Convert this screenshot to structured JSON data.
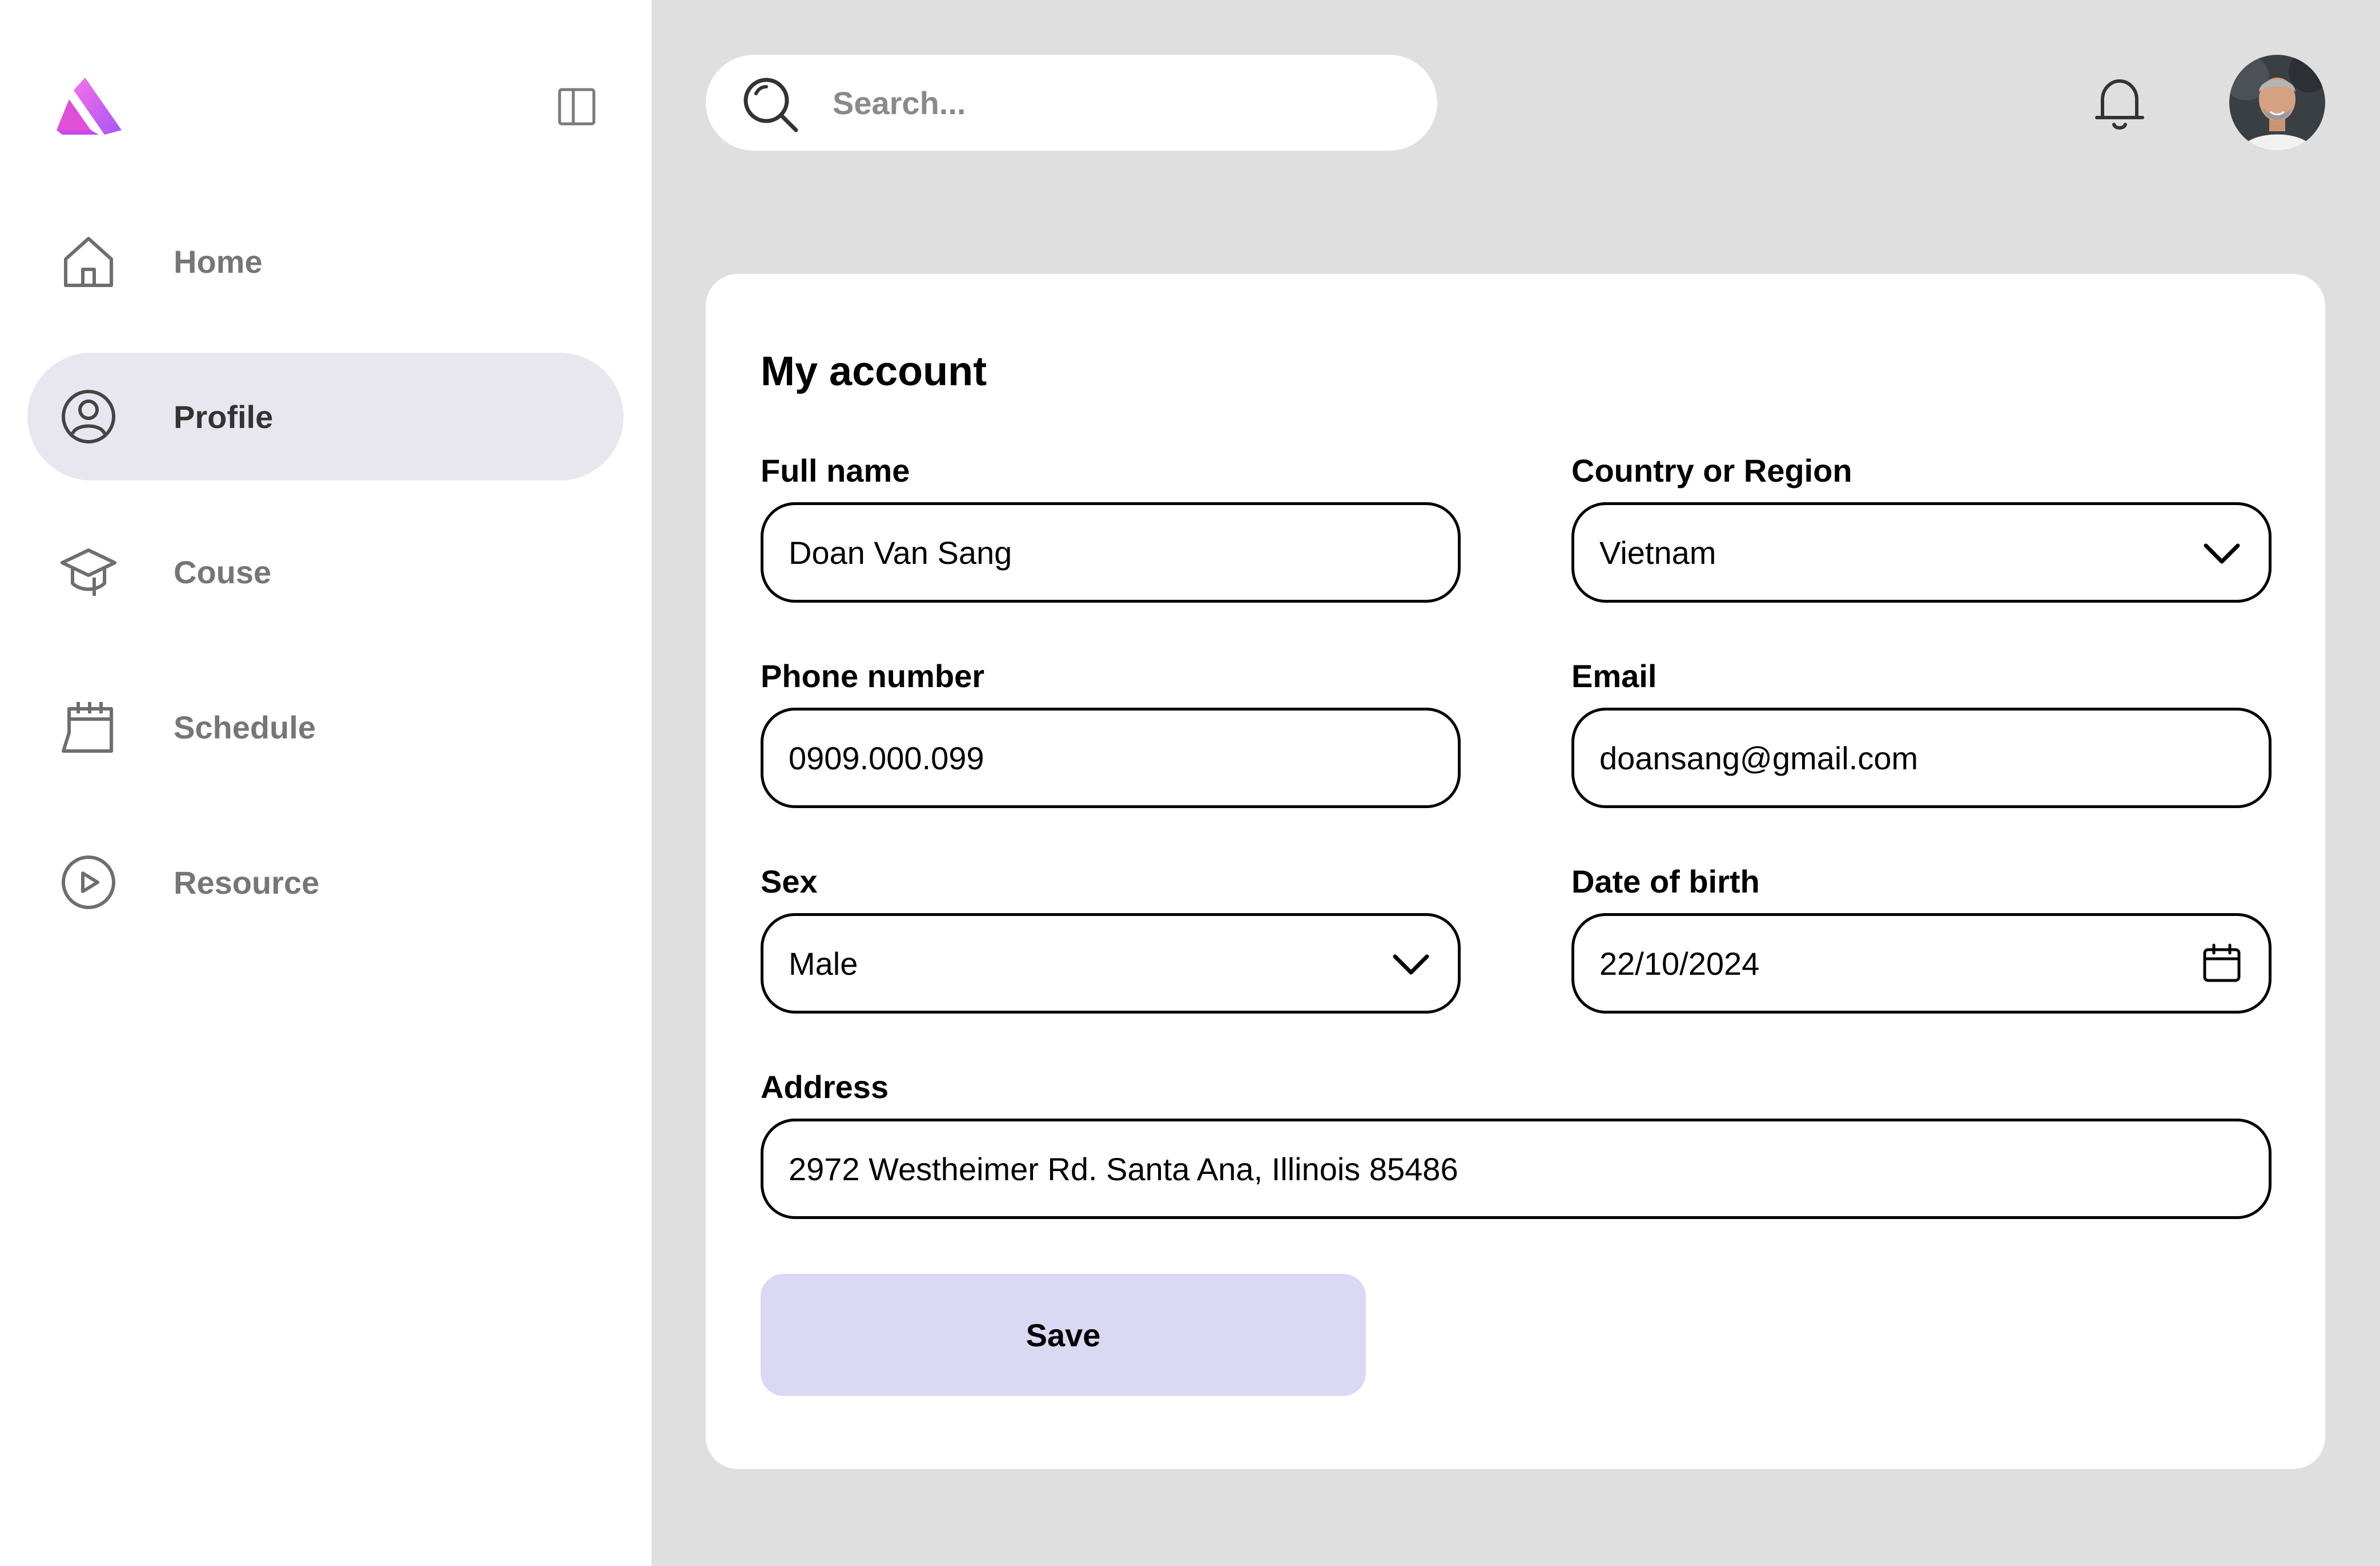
{
  "sidebar": {
    "items": [
      {
        "label": "Home",
        "icon": "home-icon",
        "active": false
      },
      {
        "label": "Profile",
        "icon": "user-circle-icon",
        "active": true
      },
      {
        "label": "Couse",
        "icon": "graduation-cap-icon",
        "active": false
      },
      {
        "label": "Schedule",
        "icon": "calendar-icon",
        "active": false
      },
      {
        "label": "Resource",
        "icon": "play-circle-icon",
        "active": false
      }
    ]
  },
  "header": {
    "search_placeholder": "Search..."
  },
  "form": {
    "title": "My account",
    "full_name": {
      "label": "Full name",
      "value": "Doan Van Sang"
    },
    "country": {
      "label": "Country or Region",
      "value": "Vietnam"
    },
    "phone": {
      "label": "Phone number",
      "value": "0909.000.099"
    },
    "email": {
      "label": "Email",
      "value": "doansang@gmail.com"
    },
    "sex": {
      "label": "Sex",
      "value": "Male"
    },
    "dob": {
      "label": "Date of birth",
      "value": "22/10/2024"
    },
    "address": {
      "label": "Address",
      "value": "2972 Westheimer Rd. Santa Ana, Illinois 85486"
    },
    "save_label": "Save"
  },
  "colors": {
    "accent": "#dbd8f3",
    "active_nav": "#e8e7f0",
    "logo_gradient_start": "#f067e8",
    "logo_gradient_end": "#a855f7"
  }
}
